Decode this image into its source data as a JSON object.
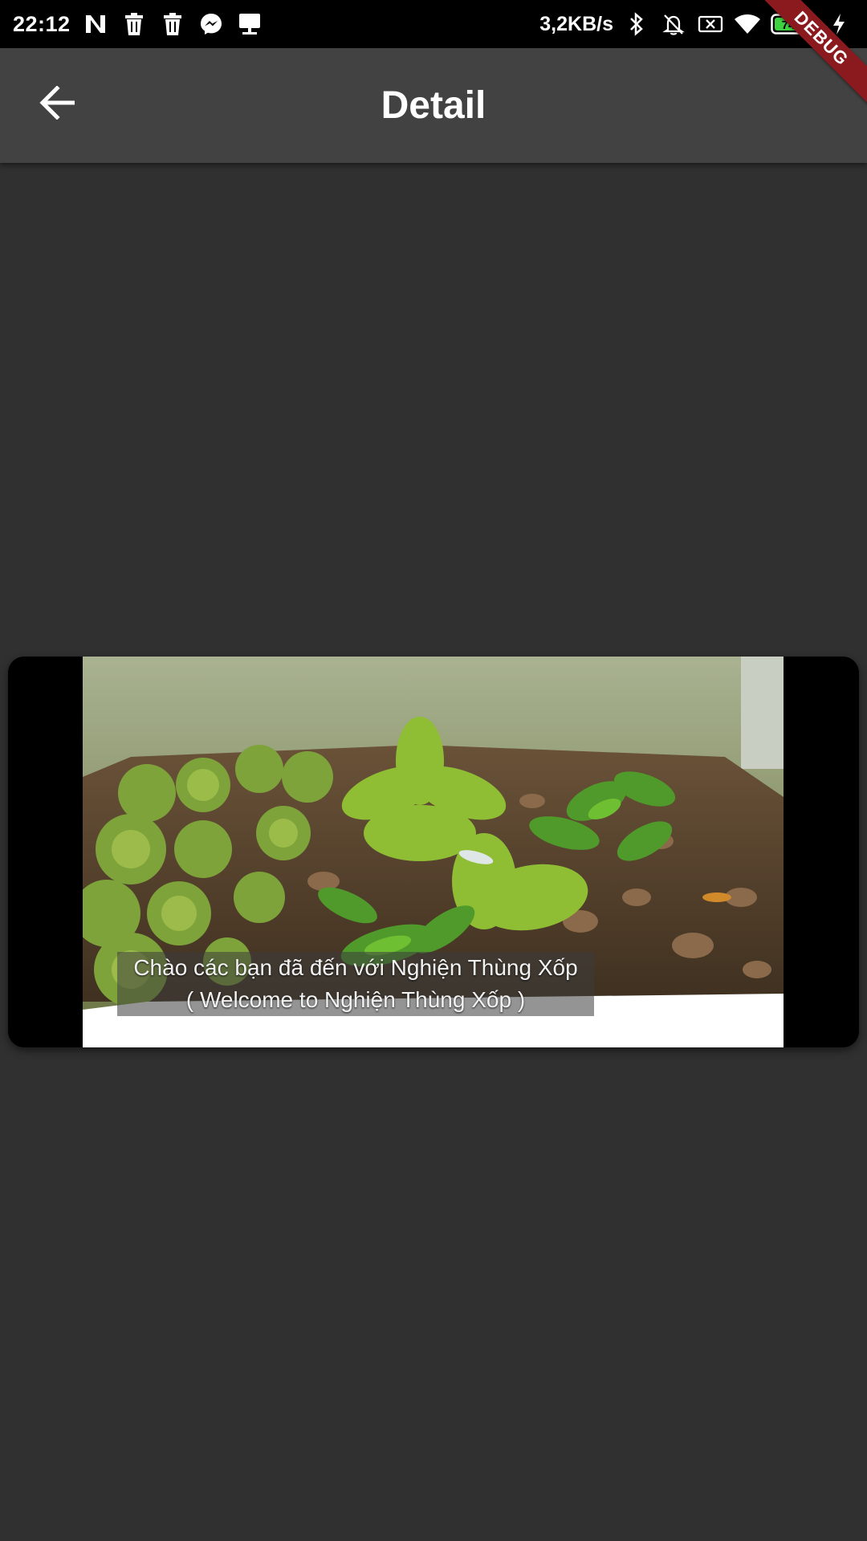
{
  "status_bar": {
    "time": "22:12",
    "net_speed": "3,2KB/s",
    "battery_level": "74",
    "notification_icons": [
      "n-app-icon",
      "trash-icon",
      "trash-icon",
      "messenger-icon",
      "tray-icon"
    ],
    "system_icons": [
      "bluetooth-icon",
      "bell-off-icon",
      "sim-off-icon",
      "wifi-icon",
      "battery-icon",
      "charging-icon"
    ]
  },
  "debug_banner": {
    "label": "DEBUG"
  },
  "app_bar": {
    "title": "Detail",
    "back_icon": "arrow-back-icon",
    "background": "#424242"
  },
  "video": {
    "subtitle_line1": "Chào các bạn đã đến với Nghiện Thùng Xốp",
    "subtitle_line2": "( Welcome to Nghiện Thùng Xốp )"
  },
  "colors": {
    "page_background": "#303030",
    "status_bar": "#000000",
    "debug_banner": "#8b1a1f",
    "battery_fill": "#3fd13f"
  }
}
